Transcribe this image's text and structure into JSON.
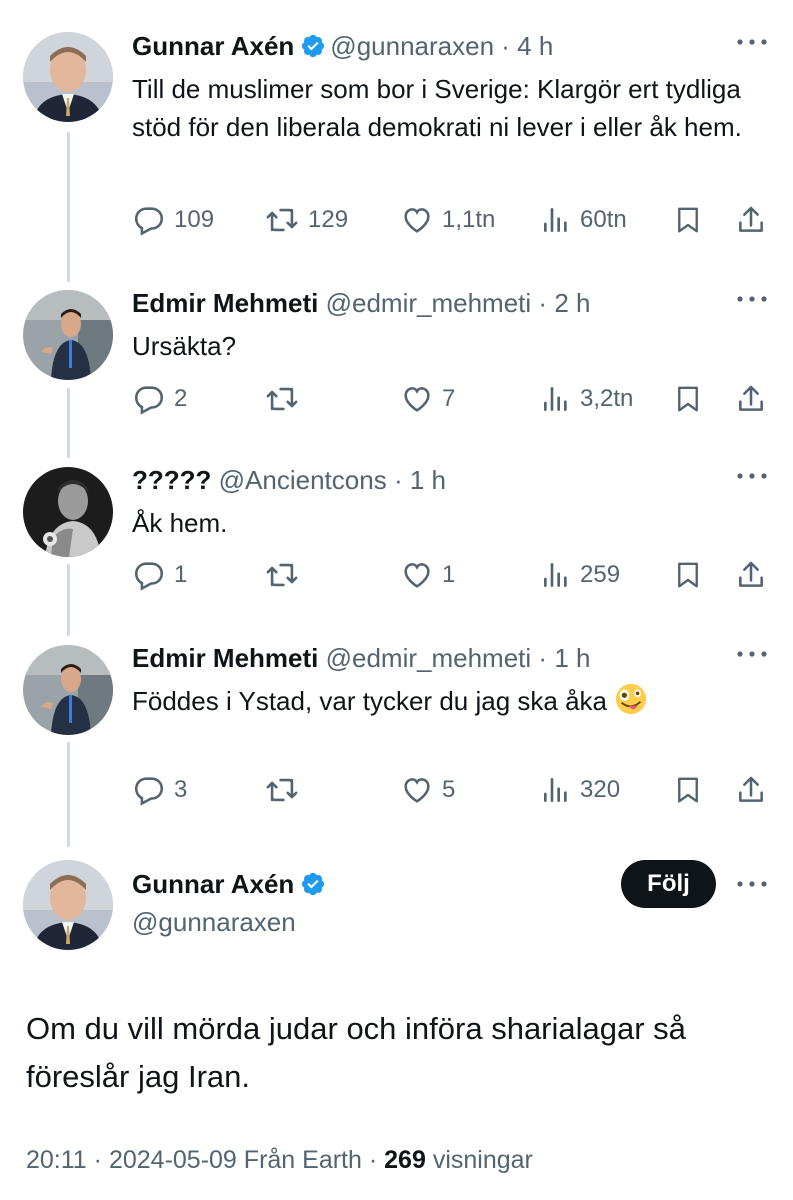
{
  "colors": {
    "text": "#0f1419",
    "muted": "#536471",
    "verified": "#1d9bf0",
    "line": "#cfd9de"
  },
  "tweets": [
    {
      "name": "Gunnar Axén",
      "verified": true,
      "handle": "@gunnaraxen",
      "sep": "·",
      "time": "4 h",
      "text": "Till de muslimer som bor i Sverige: Klargör ert tydliga stöd för den liberala demokrati ni lever i eller åk hem.",
      "replies": "109",
      "reposts": "129",
      "likes": "1,1tn",
      "views": "60tn"
    },
    {
      "name": "Edmir Mehmeti",
      "verified": false,
      "handle": "@edmir_mehmeti",
      "sep": "·",
      "time": "2 h",
      "text": "Ursäkta?",
      "replies": "2",
      "reposts": "",
      "likes": "7",
      "views": "3,2tn"
    },
    {
      "name": "?????",
      "verified": false,
      "handle": "@Ancientcons",
      "sep": "·",
      "time": "1 h",
      "text": "Åk hem.",
      "replies": "1",
      "reposts": "",
      "likes": "1",
      "views": "259"
    },
    {
      "name": "Edmir Mehmeti",
      "verified": false,
      "handle": "@edmir_mehmeti",
      "sep": "·",
      "time": "1 h",
      "text": "Föddes i Ystad, var tycker du jag ska åka",
      "emoji": "zany-face",
      "replies": "3",
      "reposts": "",
      "likes": "5",
      "views": "320"
    }
  ],
  "main_tweet": {
    "name": "Gunnar Axén",
    "verified": true,
    "handle": "@gunnaraxen",
    "follow_label": "Följ",
    "text": "Om du vill mörda judar och införa sharialagar så föreslår jag Iran.",
    "time": "20:11",
    "sep1": "·",
    "date": "2024-05-09",
    "source": "Från Earth",
    "sep2": "·",
    "views_count": "269",
    "views_label": "visningar"
  }
}
